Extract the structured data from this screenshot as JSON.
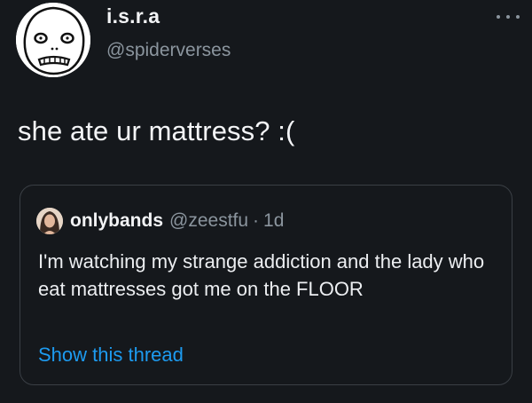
{
  "author": {
    "display_name": "i.s.r.a",
    "handle": "@spiderverses"
  },
  "tweet": {
    "text": "she ate ur mattress? :("
  },
  "quoted_tweet": {
    "display_name": "onlybands",
    "handle": "@zeestfu",
    "separator": "·",
    "time": "1d",
    "text": "I'm watching my strange addiction and the lady who eat mattresses got me on the FLOOR",
    "show_thread_label": "Show this thread"
  },
  "icons": {
    "more": "more-options-icon",
    "avatar": "avatar-ghostface-drawing",
    "quote_avatar": "avatar-photo"
  },
  "colors": {
    "background": "#15181c",
    "text_primary": "#f4f5f7",
    "text_secondary": "#8b959e",
    "link": "#1d9bf0",
    "border": "#3a3f45"
  }
}
